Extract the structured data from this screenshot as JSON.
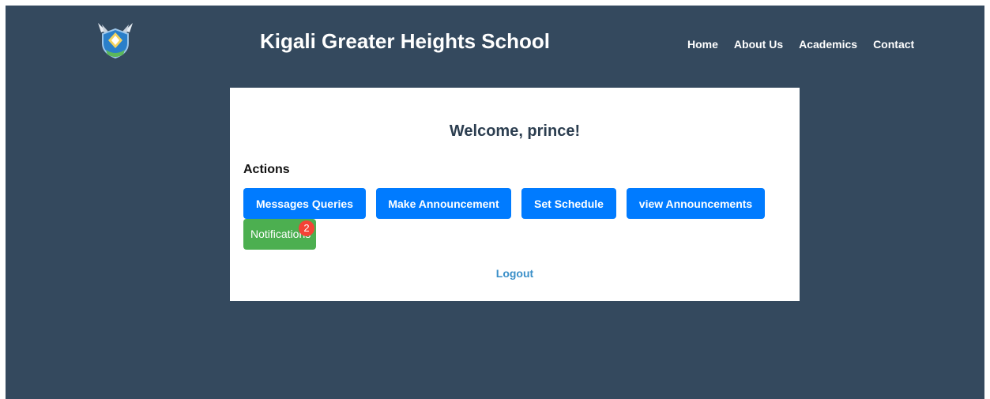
{
  "header": {
    "school_name": "Kigali Greater Heights School",
    "logo_icon": "school-crest-icon",
    "nav": [
      {
        "label": "Home"
      },
      {
        "label": "About Us"
      },
      {
        "label": "Academics"
      },
      {
        "label": "Contact"
      }
    ]
  },
  "dashboard": {
    "welcome": "Welcome, prince!",
    "actions_heading": "Actions",
    "buttons": {
      "messages_queries": "Messages Queries",
      "make_announcement": "Make Announcement",
      "set_schedule": "Set Schedule",
      "view_announcements": "view Announcements",
      "notifications": "Notifications"
    },
    "notification_count": "2",
    "logout": "Logout"
  },
  "colors": {
    "background": "#34495e",
    "primary_button": "#007bff",
    "notification_button": "#4caf50",
    "badge": "#f44336",
    "link": "#3a8fc8"
  }
}
